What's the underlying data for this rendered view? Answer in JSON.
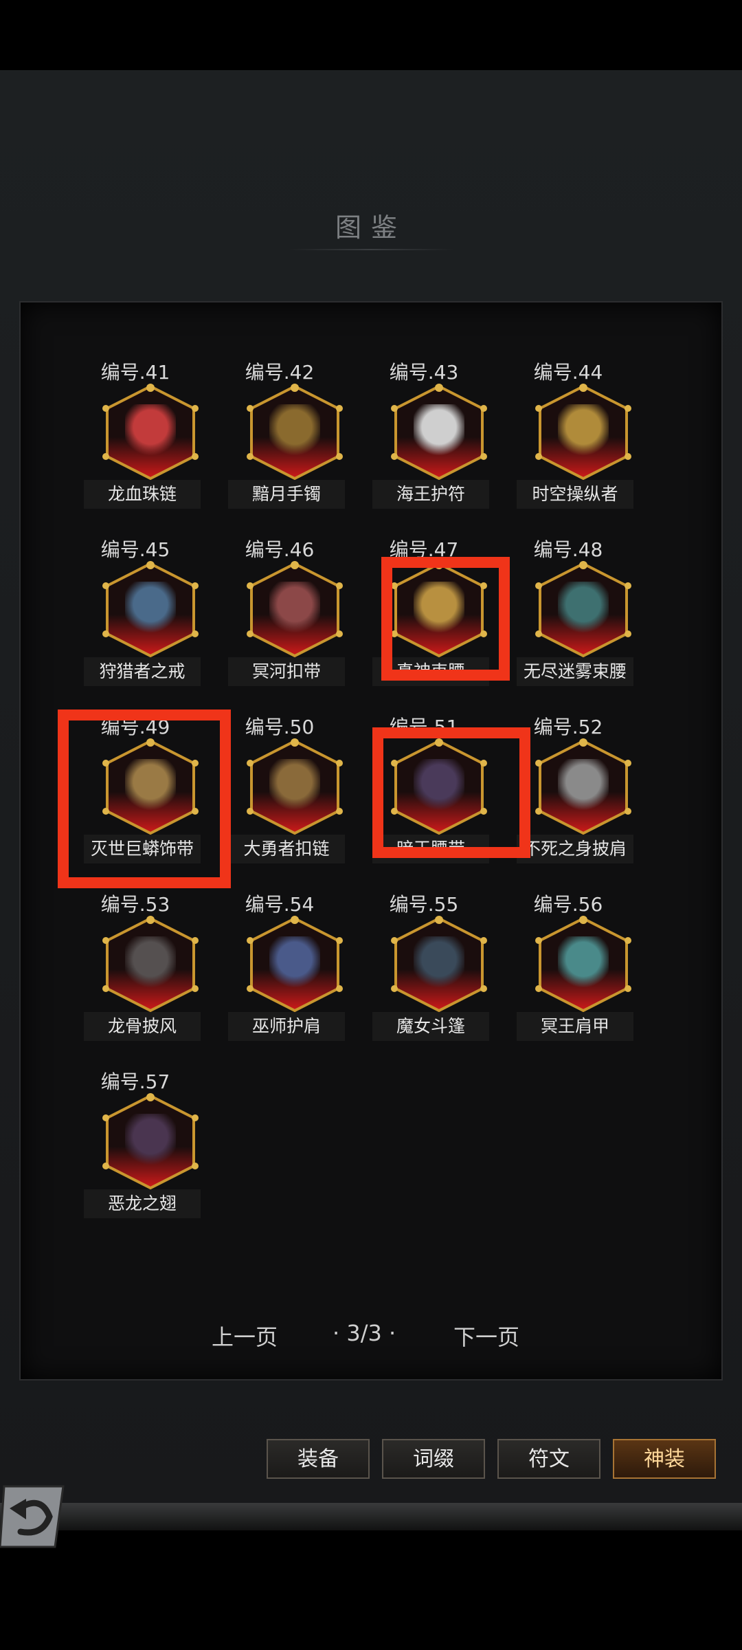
{
  "title": "图鉴",
  "items": [
    {
      "num": "编号.41",
      "name": "龙血珠链",
      "color": "#c23b3b"
    },
    {
      "num": "编号.42",
      "name": "黯月手镯",
      "color": "#8a6a2e"
    },
    {
      "num": "编号.43",
      "name": "海王护符",
      "color": "#cfcfcf"
    },
    {
      "num": "编号.44",
      "name": "时空操纵者",
      "color": "#b08b3a"
    },
    {
      "num": "编号.45",
      "name": "狩猎者之戒",
      "color": "#4a6a8a"
    },
    {
      "num": "编号.46",
      "name": "冥河扣带",
      "color": "#8c4848"
    },
    {
      "num": "编号.47",
      "name": "真神束腰",
      "color": "#b89040"
    },
    {
      "num": "编号.48",
      "name": "无尽迷雾束腰",
      "color": "#3e7070"
    },
    {
      "num": "编号.49",
      "name": "灭世巨蟒饰带",
      "color": "#9a7a45"
    },
    {
      "num": "编号.50",
      "name": "大勇者扣链",
      "color": "#8a6a3a"
    },
    {
      "num": "编号.51",
      "name": "暗王腰带",
      "color": "#4a3a5a"
    },
    {
      "num": "编号.52",
      "name": "不死之身披肩",
      "color": "#8a8a8a"
    },
    {
      "num": "编号.53",
      "name": "龙骨披风",
      "color": "#555050"
    },
    {
      "num": "编号.54",
      "name": "巫师护肩",
      "color": "#4a5a8a"
    },
    {
      "num": "编号.55",
      "name": "魔女斗篷",
      "color": "#3a4a5a"
    },
    {
      "num": "编号.56",
      "name": "冥王肩甲",
      "color": "#4a8a8a"
    },
    {
      "num": "编号.57",
      "name": "恶龙之翅",
      "color": "#4a3550"
    }
  ],
  "pager": {
    "prev": "上一页",
    "page": "· 3/3 ·",
    "next": "下一页"
  },
  "tabs": [
    "装备",
    "词缀",
    "符文",
    "神装"
  ],
  "active_tab": "神装"
}
